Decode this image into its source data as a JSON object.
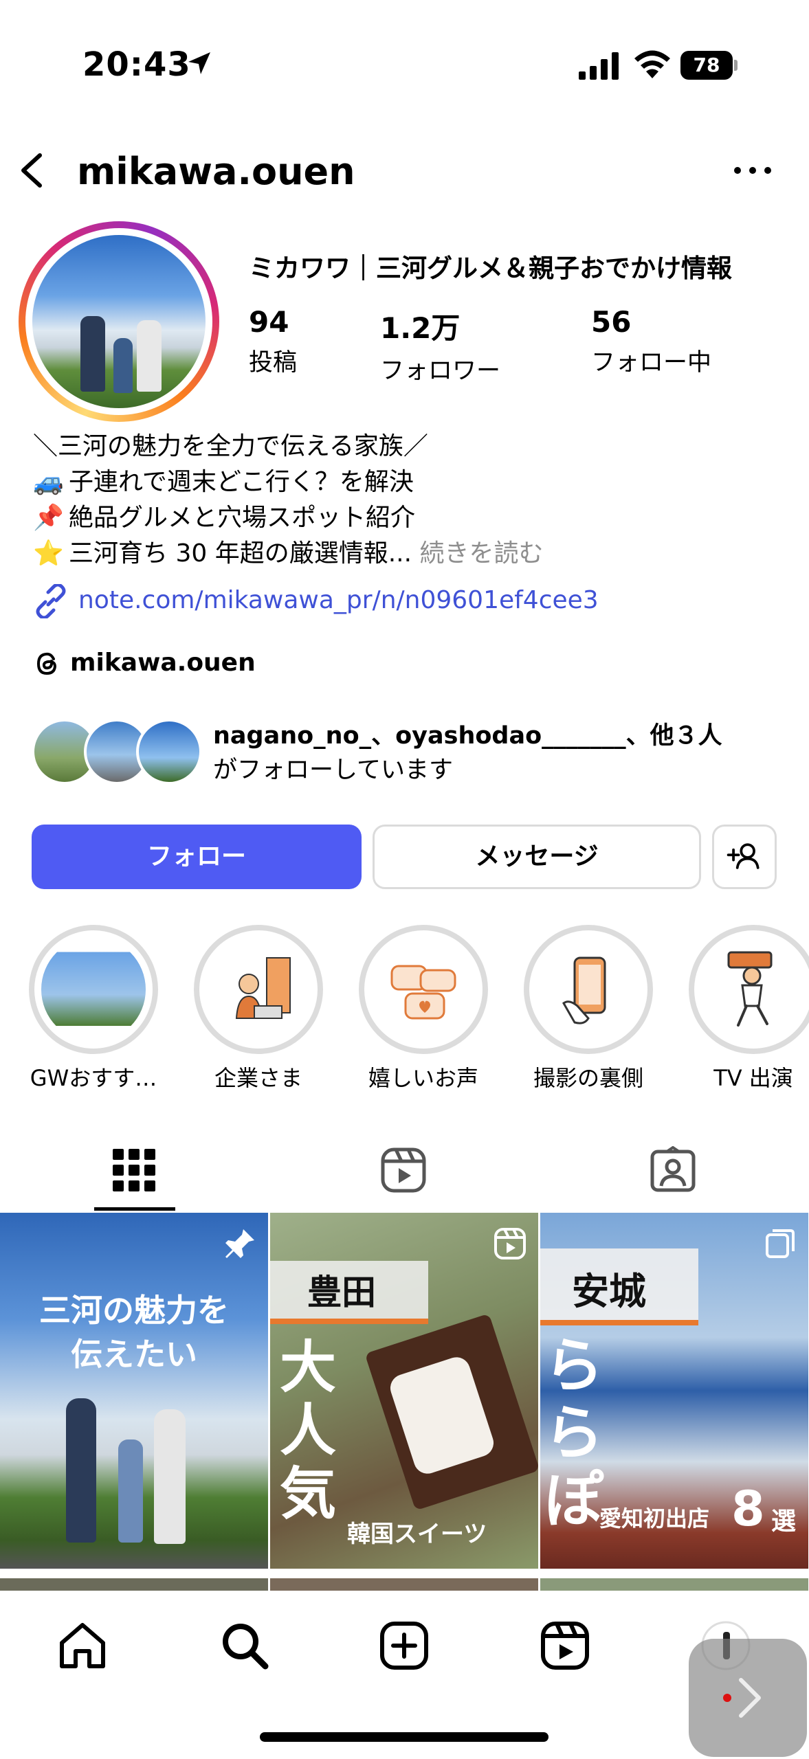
{
  "status_bar": {
    "time": "20:43",
    "battery": "78"
  },
  "header": {
    "username": "mikawa.ouen"
  },
  "profile": {
    "display_name": "ミカワワ｜三河グルメ＆親子おでかけ情報",
    "stats": [
      {
        "value": "94",
        "label": "投稿"
      },
      {
        "value": "1.2万",
        "label": "フォロワー"
      },
      {
        "value": "56",
        "label": "フォロー中"
      }
    ],
    "bio": {
      "line1": "＼三河の魅力を全力で伝える家族／",
      "line2_emoji": "🚙",
      "line2": "子連れで週末どこ行く？を解決",
      "line3_emoji": "📌",
      "line3": "絶品グルメと穴場スポット紹介",
      "line4_emoji": "⭐",
      "line4": "三河育ち 30 年超の厳選情報...",
      "more": "続きを読む"
    },
    "link": "note.com/mikawawa_pr/n/n09601ef4cee3",
    "threads": "mikawa.ouen",
    "followed_by": {
      "names": "nagano_no_、oyashodao_______、他３人",
      "suffix": "がフォローしています"
    }
  },
  "buttons": {
    "follow": "フォロー",
    "message": "メッセージ"
  },
  "highlights": [
    {
      "label": "GWおすす…"
    },
    {
      "label": "企業さま"
    },
    {
      "label": "嬉しいお声"
    },
    {
      "label": "撮影の裏側"
    },
    {
      "label": "TV 出演"
    }
  ],
  "posts": [
    {
      "overlay": "三河の魅力を\n伝えたい"
    },
    {
      "tag": "豊田",
      "big": "大\n人\n気",
      "sub": "韓国スイーツ"
    },
    {
      "tag": "安城",
      "big": "ら\nら\nぽ",
      "sub": "愛知初出店",
      "num": "8",
      "suffix": "選"
    }
  ],
  "colors": {
    "accent": "#4f5bf3",
    "link": "#3f51d6",
    "muted": "#8e8e8e"
  },
  "icons": [
    "location-arrow-icon",
    "signal-icon",
    "wifi-icon",
    "battery-icon",
    "back-arrow-icon",
    "more-icon",
    "link-icon",
    "threads-icon",
    "add-user-icon",
    "grid-icon",
    "reels-icon",
    "tagged-icon",
    "pin-icon",
    "home-icon",
    "search-icon",
    "create-icon"
  ]
}
